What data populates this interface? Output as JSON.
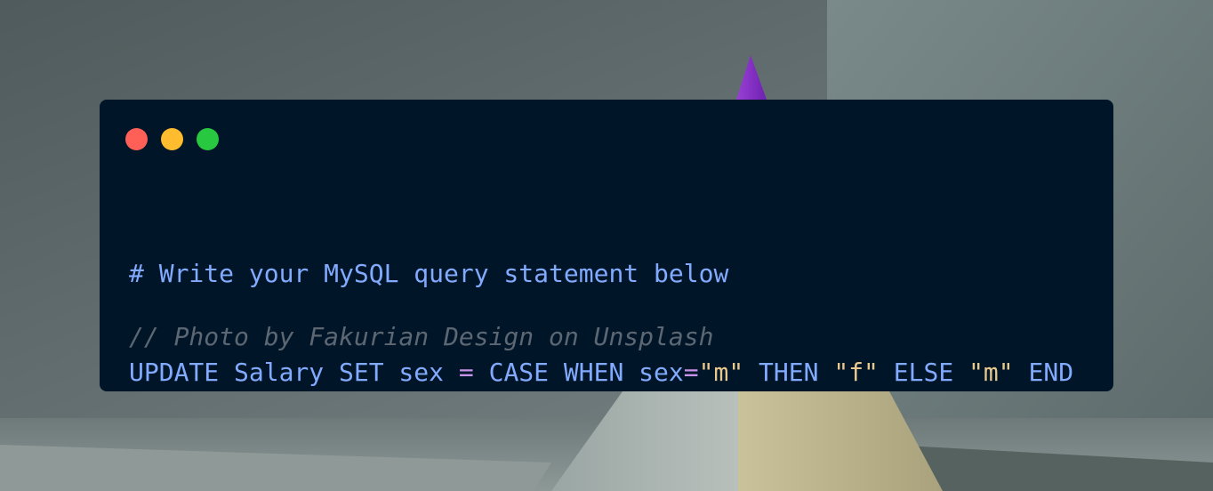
{
  "window_controls": [
    {
      "name": "close",
      "color": "#fe5f57"
    },
    {
      "name": "minimize",
      "color": "#febc2e"
    },
    {
      "name": "maximize",
      "color": "#28c840"
    }
  ],
  "colors": {
    "window_background": "#001628",
    "keyword": "#82aaff",
    "operator": "#c792ea",
    "string": "#e8c88e",
    "comment": "#8aa3c3",
    "credit_comment": "#5c6773"
  },
  "code": {
    "comment_line": "# Write your MySQL query statement below",
    "statement": [
      {
        "text": "UPDATE Salary SET sex ",
        "kind": "keyword"
      },
      {
        "text": "=",
        "kind": "operator"
      },
      {
        "text": " CASE WHEN sex",
        "kind": "keyword"
      },
      {
        "text": "=",
        "kind": "operator"
      },
      {
        "text": "\"m\"",
        "kind": "string"
      },
      {
        "text": " THEN ",
        "kind": "keyword"
      },
      {
        "text": "\"f\"",
        "kind": "string"
      },
      {
        "text": " ELSE ",
        "kind": "keyword"
      },
      {
        "text": "\"m\"",
        "kind": "string"
      },
      {
        "text": " END",
        "kind": "keyword"
      }
    ]
  },
  "credit": "// Photo by Fakurian Design on Unsplash"
}
